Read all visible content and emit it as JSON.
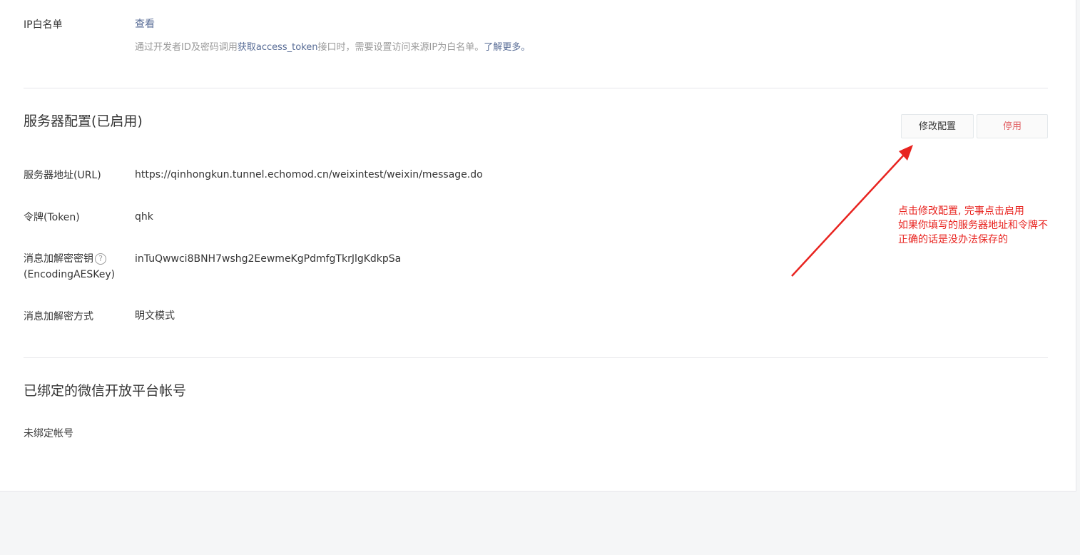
{
  "ip_whitelist": {
    "label": "IP白名单",
    "view_link": "查看",
    "description_prefix": "通过开发者ID及密码调用",
    "description_api": "获取access_token",
    "description_suffix": "接口时，需要设置访问来源IP为白名单。",
    "learn_more": "了解更多。"
  },
  "server_config": {
    "title": "服务器配置(已启用)",
    "modify_button": "修改配置",
    "stop_button": "停用",
    "url_label": "服务器地址(URL)",
    "url_value": "https://qinhongkun.tunnel.echomod.cn/weixintest/weixin/message.do",
    "token_label": "令牌(Token)",
    "token_value": "qhk",
    "aeskey_label_line1": "消息加解密密钥",
    "help_glyph": "?",
    "aeskey_label_line2": "(EncodingAESKey)",
    "aeskey_value": "inTuQwwci8BNH7wshg2EewmeKgPdmfgTkrJlgKdkpSa",
    "encrypt_mode_label": "消息加解密方式",
    "encrypt_mode_value": "明文模式"
  },
  "bound_accounts": {
    "title": "已绑定的微信开放平台帐号",
    "status": "未绑定帐号"
  },
  "annotation": {
    "lines": [
      "点击修改配置, 完事点击启用",
      "如果你填写的服务器地址和令牌不",
      "正确的话是没办法保存的"
    ],
    "color": "#e8231f"
  },
  "colors": {
    "link": "#576b95",
    "danger": "#e15f63",
    "background": "#f5f6f7"
  }
}
